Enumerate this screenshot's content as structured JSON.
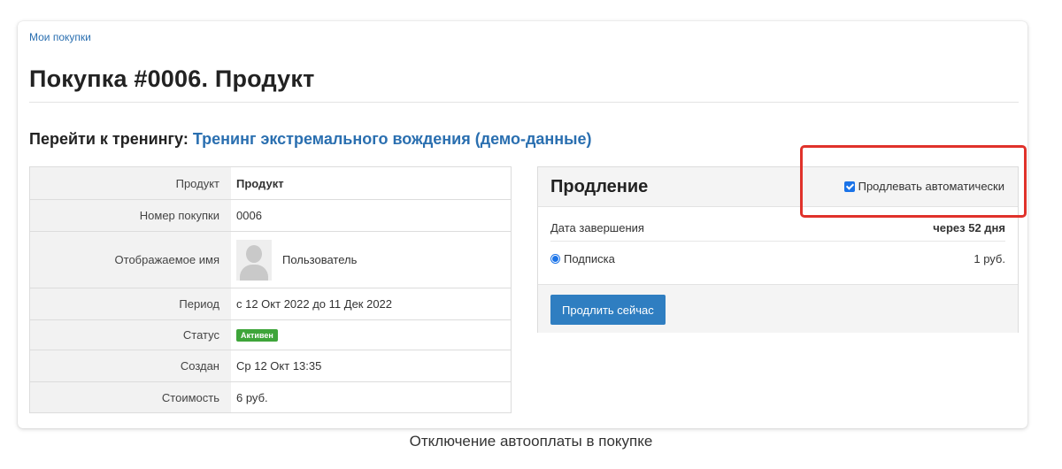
{
  "breadcrumb": "Мои покупки",
  "page_title": "Покупка #0006. Продукт",
  "training": {
    "label": "Перейти к тренингу:",
    "link": "Тренинг экстремального вождения (демо-данные)"
  },
  "details": {
    "product": {
      "label": "Продукт",
      "value": "Продукт"
    },
    "number": {
      "label": "Номер покупки",
      "value": "0006"
    },
    "display_name": {
      "label": "Отображаемое имя",
      "value": "Пользователь"
    },
    "period": {
      "label": "Период",
      "value": "с 12 Окт 2022 до 11 Дек 2022"
    },
    "status": {
      "label": "Статус",
      "value": "Активен"
    },
    "created": {
      "label": "Создан",
      "value": "Ср 12 Окт 13:35"
    },
    "cost": {
      "label": "Стоимость",
      "value": "6 руб."
    }
  },
  "renewal": {
    "title": "Продление",
    "auto_label": "Продлевать автоматически",
    "auto_checked": true,
    "end_label": "Дата завершения",
    "end_value": "через 52 дня",
    "plan_label": "Подписка",
    "plan_price": "1 руб.",
    "button": "Продлить сейчас"
  },
  "caption": "Отключение автооплаты в покупке",
  "colors": {
    "link": "#2a6fb0",
    "button": "#2f7ec1",
    "badge": "#3ea53a",
    "highlight": "#e0322b",
    "checkbox": "#1a73e8"
  }
}
